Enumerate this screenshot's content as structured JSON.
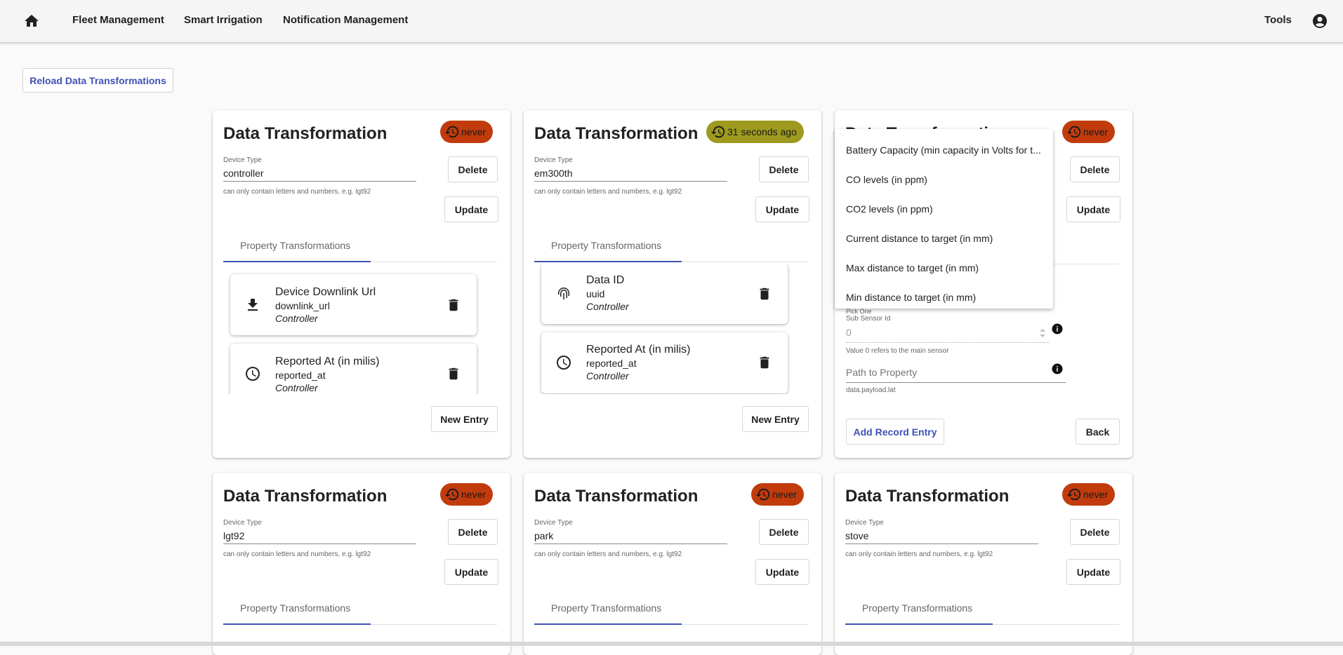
{
  "nav": {
    "items": [
      "Fleet Management",
      "Smart Irrigation",
      "Notification Management"
    ],
    "tools": "Tools"
  },
  "reload_label": "Reload Data Transformations",
  "common": {
    "title": "Data Transformation",
    "device_type_label": "Device Type",
    "hint": "can only contain letters and numbers, e.g. lgt92",
    "delete": "Delete",
    "update": "Update",
    "tab": "Property Transformations",
    "new_entry": "New Entry"
  },
  "cards": [
    {
      "badge": "never",
      "device_type": "controller",
      "transformations": [
        {
          "name": "Device Downlink Url",
          "key": "downlink_url",
          "controller": "Controller",
          "icon": "download-icon"
        },
        {
          "name": "Reported At (in milis)",
          "key": "reported_at",
          "controller": "Controller",
          "icon": "clock-icon"
        }
      ]
    },
    {
      "badge": "31 seconds ago",
      "device_type": "em300th",
      "transformations": [
        {
          "name": "Data ID",
          "key": "uuid",
          "controller": "Controller",
          "icon": "fingerprint-icon"
        },
        {
          "name": "Reported At (in milis)",
          "key": "reported_at",
          "controller": "Controller",
          "icon": "clock-icon"
        }
      ]
    },
    {
      "badge": "never",
      "title_partial": "Data Transformation"
    },
    {
      "badge": "never",
      "device_type": "lgt92"
    },
    {
      "badge": "never",
      "device_type": "park"
    },
    {
      "badge": "never",
      "device_type": "stove"
    }
  ],
  "menu": {
    "options": [
      "Battery Capacity (min capacity in Volts for t...",
      "CO levels (in ppm)",
      "CO2 levels (in ppm)",
      "Current distance to target (in mm)",
      "Max distance to target (in mm)",
      "Min distance to target (in mm)"
    ]
  },
  "form": {
    "pick_one": "Pick One",
    "sub_sensor_label": "Sub Sensor Id",
    "sub_sensor_value": "0",
    "sub_sensor_hint": "Value 0 refers to the main sensor",
    "path_placeholder": "Path to Property",
    "path_hint": "data.payload.lat",
    "add_record": "Add Record Entry",
    "back": "Back"
  }
}
